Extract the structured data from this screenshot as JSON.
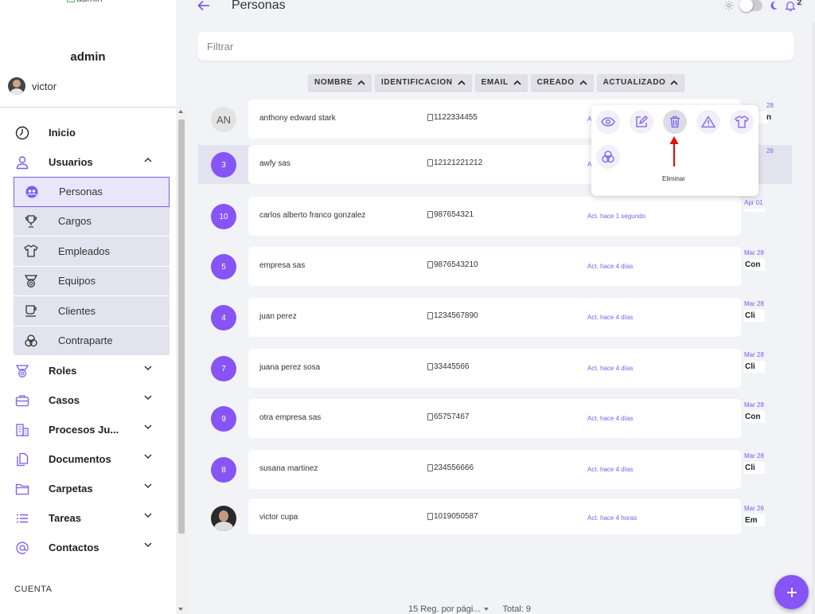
{
  "sidebar": {
    "logo_alt": "admin",
    "user_title": "admin",
    "username": "victor",
    "menu": [
      {
        "label": "Inicio",
        "icon": "clock-icon"
      },
      {
        "label": "Usuarios",
        "icon": "user-icon",
        "expanded": true
      }
    ],
    "submenu": [
      {
        "label": "Personas",
        "icon": "people-icon",
        "active": true
      },
      {
        "label": "Cargos",
        "icon": "trophy-icon"
      },
      {
        "label": "Empleados",
        "icon": "shirt-icon"
      },
      {
        "label": "Equipos",
        "icon": "medal-icon"
      },
      {
        "label": "Clientes",
        "icon": "cup-icon"
      },
      {
        "label": "Contraparte",
        "icon": "circles-icon"
      }
    ],
    "menu_rest": [
      {
        "label": "Roles",
        "icon": "medal-icon"
      },
      {
        "label": "Casos",
        "icon": "briefcase-icon"
      },
      {
        "label": "Procesos Ju...",
        "icon": "building-icon"
      },
      {
        "label": "Documentos",
        "icon": "documents-icon"
      },
      {
        "label": "Carpetas",
        "icon": "folder-icon"
      },
      {
        "label": "Tareas",
        "icon": "list-icon"
      },
      {
        "label": "Contactos",
        "icon": "at-icon"
      }
    ],
    "section_label": "CUENTA"
  },
  "header": {
    "title": "Personas",
    "notification_count": "2"
  },
  "filter": {
    "placeholder": "Filtrar"
  },
  "sort_chips": [
    "NOMBRE",
    "IDENTIFICACION",
    "EMAIL",
    "CREADO",
    "ACTUALIZADO"
  ],
  "rows": [
    {
      "avatar": "AN",
      "avatar_type": "initials",
      "name": "anthony edward stark",
      "ident": "1122334455",
      "updated": "Ac",
      "date": "28",
      "tag": "n"
    },
    {
      "avatar": "3",
      "avatar_type": "number",
      "name": "awfy sas",
      "ident": "12121221212",
      "updated": "A",
      "date": "26",
      "tag": "",
      "selected": true
    },
    {
      "avatar": "10",
      "avatar_type": "number",
      "name": "carlos alberto franco gonzalez",
      "ident": "987654321",
      "updated": "Act. hace 1 segundo",
      "date": "Apr 01",
      "tag": ""
    },
    {
      "avatar": "5",
      "avatar_type": "number",
      "name": "empresa sas",
      "ident": "9876543210",
      "updated": "Act. hace 4 días",
      "date": "Mar 28",
      "tag": "Con"
    },
    {
      "avatar": "4",
      "avatar_type": "number",
      "name": "juan perez",
      "ident": "1234567890",
      "updated": "Act. hace 4 días",
      "date": "Mar 28",
      "tag": "Cli"
    },
    {
      "avatar": "7",
      "avatar_type": "number",
      "name": "juana perez sosa",
      "ident": "33445566",
      "updated": "Act. hace 4 días",
      "date": "Mar 28",
      "tag": "Cli"
    },
    {
      "avatar": "9",
      "avatar_type": "number",
      "name": "otra empresa sas",
      "ident": "65757467",
      "updated": "Act. hace 4 días",
      "date": "Mar 28",
      "tag": "Con"
    },
    {
      "avatar": "8",
      "avatar_type": "number",
      "name": "susana martinez",
      "ident": "234556666",
      "updated": "Act. hace 4 días",
      "date": "Mar 28",
      "tag": "Cli"
    },
    {
      "avatar": "",
      "avatar_type": "photo",
      "name": "victor cupa",
      "ident": "1019050587",
      "updated": "Act. hace 4 horas",
      "date": "Mar 26",
      "tag": "Em"
    }
  ],
  "popup": {
    "actions": [
      "eye-icon",
      "edit-icon",
      "trash-icon",
      "warning-icon",
      "shirt-icon",
      "circles-icon"
    ],
    "hovered_label": "Eliminar"
  },
  "footer": {
    "per_page": "15 Reg. por pági...",
    "total": "Total: 9"
  },
  "colors": {
    "accent": "#8754f5",
    "accent_text": "#7b5cf0",
    "annotation_arrow": "#e01010"
  }
}
